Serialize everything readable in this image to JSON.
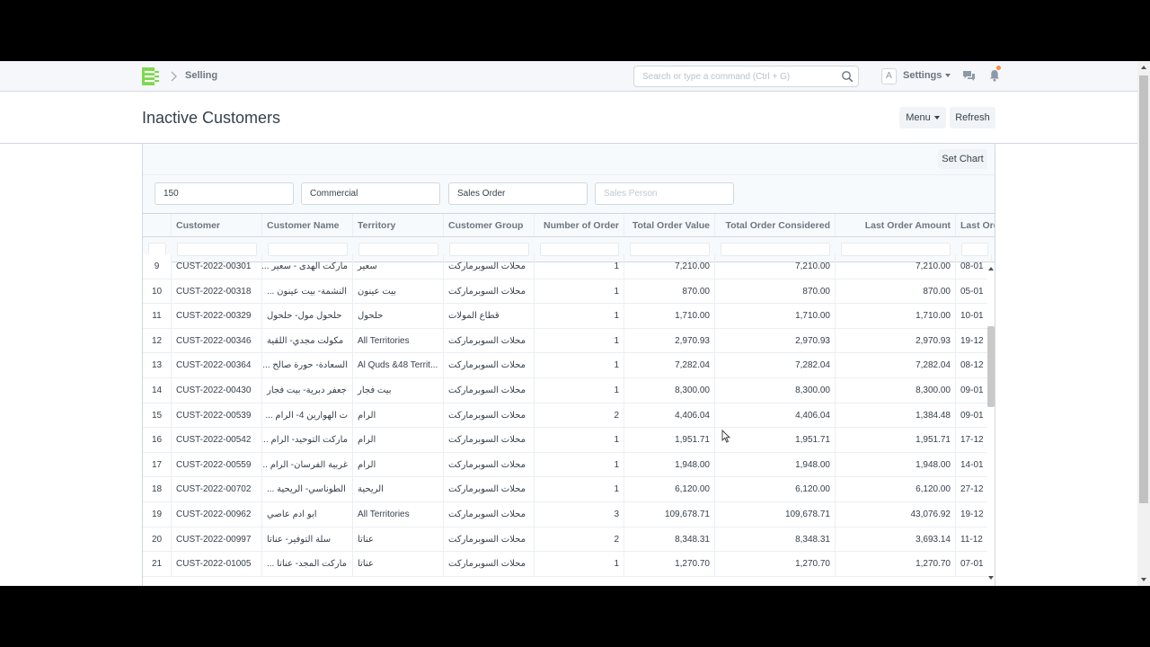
{
  "navbar": {
    "breadcrumb": "Selling",
    "search_placeholder": "Search or type a command (Ctrl + G)",
    "avatar_letter": "A",
    "settings_label": "Settings",
    "brand_color": "#7cd94f"
  },
  "page": {
    "title": "Inactive Customers",
    "menu_label": "Menu",
    "refresh_label": "Refresh",
    "set_chart_label": "Set Chart"
  },
  "filters": [
    {
      "value": "150",
      "placeholder": ""
    },
    {
      "value": "Commercial",
      "placeholder": ""
    },
    {
      "value": "Sales Order",
      "placeholder": ""
    },
    {
      "value": "",
      "placeholder": "Sales Person"
    }
  ],
  "table": {
    "columns": [
      "Customer",
      "Customer Name",
      "Territory",
      "Customer Group",
      "Number of Order",
      "Total Order Value",
      "Total Order Considered",
      "Last Order Amount",
      "Last Ord"
    ],
    "rows": [
      {
        "idx": "9",
        "customer": "CUST-2022-00301",
        "name": "ماركت الهدى - سعير ...",
        "territory": "سعير",
        "group": "محلات السوبرماركت",
        "orders": "1",
        "total_value": "7,210.00",
        "considered": "7,210.00",
        "last_amount": "7,210.00",
        "last_date": "08-01"
      },
      {
        "idx": "10",
        "customer": "CUST-2022-00318",
        "name": "النشمة- بيت عينون ...",
        "territory": "بيت عينون",
        "group": "محلات السوبرماركت",
        "orders": "1",
        "total_value": "870.00",
        "considered": "870.00",
        "last_amount": "870.00",
        "last_date": "05-01"
      },
      {
        "idx": "11",
        "customer": "CUST-2022-00329",
        "name": "حلحول مول- حلحول",
        "territory": "حلحول",
        "group": "قطاع المولات",
        "orders": "1",
        "total_value": "1,710.00",
        "considered": "1,710.00",
        "last_amount": "1,710.00",
        "last_date": "10-01"
      },
      {
        "idx": "12",
        "customer": "CUST-2022-00346",
        "name": "مكولت مجدي- اللقية",
        "territory": "All Territories",
        "group": "محلات السوبرماركت",
        "orders": "1",
        "total_value": "2,970.93",
        "considered": "2,970.93",
        "last_amount": "2,970.93",
        "last_date": "19-12"
      },
      {
        "idx": "13",
        "customer": "CUST-2022-00364",
        "name": "السعادة- حورة صالح ...",
        "territory": "Al Quds &48 Territ...",
        "group": "محلات السوبرماركت",
        "orders": "1",
        "total_value": "7,282.04",
        "considered": "7,282.04",
        "last_amount": "7,282.04",
        "last_date": "08-12"
      },
      {
        "idx": "14",
        "customer": "CUST-2022-00430",
        "name": "جعفر دبرية- بيت فجار",
        "territory": "بيت فجار",
        "group": "محلات السوبرماركت",
        "orders": "1",
        "total_value": "8,300.00",
        "considered": "8,300.00",
        "last_amount": "8,300.00",
        "last_date": "09-01"
      },
      {
        "idx": "15",
        "customer": "CUST-2022-00539",
        "name": "ت الهوارين 4- الرام ...",
        "territory": "الرام",
        "group": "محلات السوبرماركت",
        "orders": "2",
        "total_value": "4,406.04",
        "considered": "4,406.04",
        "last_amount": "1,384.48",
        "last_date": "09-01"
      },
      {
        "idx": "16",
        "customer": "CUST-2022-00542",
        "name": "ماركت التوحيد- الرام ...",
        "territory": "الرام",
        "group": "محلات السوبرماركت",
        "orders": "1",
        "total_value": "1,951.71",
        "considered": "1,951.71",
        "last_amount": "1,951.71",
        "last_date": "17-12"
      },
      {
        "idx": "17",
        "customer": "CUST-2022-00559",
        "name": "غربية الفرسان- الرام ...",
        "territory": "الرام",
        "group": "محلات السوبرماركت",
        "orders": "1",
        "total_value": "1,948.00",
        "considered": "1,948.00",
        "last_amount": "1,948.00",
        "last_date": "14-01"
      },
      {
        "idx": "18",
        "customer": "CUST-2022-00702",
        "name": "الطوناسي- الريحية ...",
        "territory": "الريحية",
        "group": "محلات السوبرماركت",
        "orders": "1",
        "total_value": "6,120.00",
        "considered": "6,120.00",
        "last_amount": "6,120.00",
        "last_date": "27-12"
      },
      {
        "idx": "19",
        "customer": "CUST-2022-00962",
        "name": "ابو ادم عاصي",
        "territory": "All Territories",
        "group": "محلات السوبرماركت",
        "orders": "3",
        "total_value": "109,678.71",
        "considered": "109,678.71",
        "last_amount": "43,076.92",
        "last_date": "19-12"
      },
      {
        "idx": "20",
        "customer": "CUST-2022-00997",
        "name": "سلة التوفير- عناتا",
        "territory": "عناتا",
        "group": "محلات السوبرماركت",
        "orders": "2",
        "total_value": "8,348.31",
        "considered": "8,348.31",
        "last_amount": "3,693.14",
        "last_date": "11-12"
      },
      {
        "idx": "21",
        "customer": "CUST-2022-01005",
        "name": "ماركت المجد- عناتا ...",
        "territory": "عناتا",
        "group": "محلات السوبرماركت",
        "orders": "1",
        "total_value": "1,270.70",
        "considered": "1,270.70",
        "last_amount": "1,270.70",
        "last_date": "07-01"
      }
    ]
  }
}
